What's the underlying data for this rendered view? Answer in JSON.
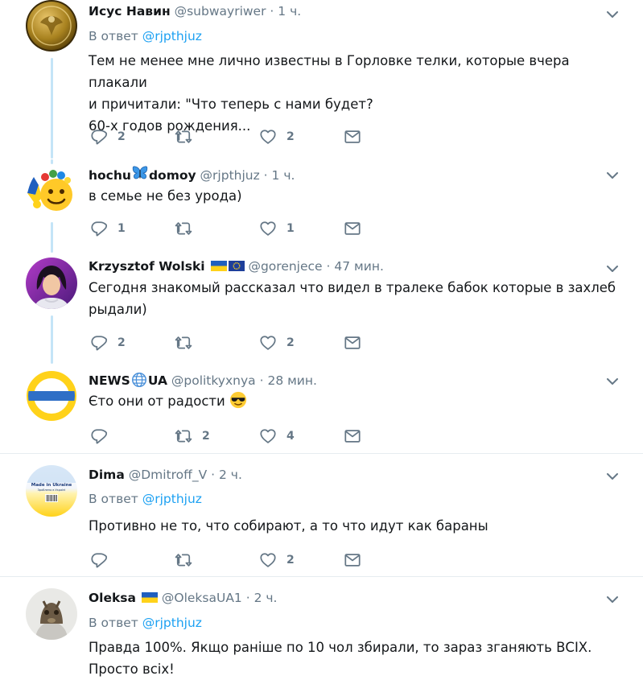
{
  "tweets": [
    {
      "name": "Исус Навин",
      "handle": "@subwayriwer",
      "time": "1 ч.",
      "reply_prefix": "В ответ",
      "reply_to": "@rjpthjuz",
      "text": [
        "Тем не менее мне лично известны в Горловке телки, которые вчера плакали",
        "и причитали: \"Что теперь с нами будет?",
        "60-х годов рождения..."
      ],
      "replies": "2",
      "retweets": "",
      "likes": "2"
    },
    {
      "name_part1": "hochu",
      "name_part2": "domoy",
      "handle": "@rjpthjuz",
      "time": "1 ч.",
      "text": [
        "в семье не без урода)"
      ],
      "replies": "1",
      "retweets": "",
      "likes": "1"
    },
    {
      "name": "Krzysztof Wolski",
      "handle": "@gorenjece",
      "time": "47 мин.",
      "text": [
        "Сегодня знакомый рассказал что видел в тралеке бабок которые в захлеб",
        "рыдали)"
      ],
      "replies": "2",
      "retweets": "",
      "likes": "2"
    },
    {
      "name_part1": "NEWS",
      "name_part2": "UA",
      "handle": "@politkyxnya",
      "time": "28 мин.",
      "text": [
        "Єто они от радости"
      ],
      "replies": "",
      "retweets": "2",
      "likes": "4"
    },
    {
      "name": "Dima",
      "handle": "@Dmitroff_V",
      "time": "2 ч.",
      "reply_prefix": "В ответ",
      "reply_to": "@rjpthjuz",
      "text": [
        "Противно не то, что собирают, а то что идут как бараны"
      ],
      "replies": "",
      "retweets": "",
      "likes": "2",
      "avatar_text": [
        "Made in Ukraine",
        "Зроблено в Україні"
      ]
    },
    {
      "name": "Oleksa",
      "handle": "@OleksaUA1",
      "time": "2 ч.",
      "reply_prefix": "В ответ",
      "reply_to": "@rjpthjuz",
      "text": [
        "Правда 100%. Якщо раніше по 10 чол збирали, то зараз зганяють ВСІХ.",
        "Просто всіх!"
      ]
    }
  ],
  "dot": "·",
  "colors": {
    "accent": "#1da1f2",
    "muted": "#657786",
    "thread_line": "#c4e4f7",
    "separator": "#e6ecf0"
  },
  "icons": {
    "reply": "reply-icon",
    "retweet": "retweet-icon",
    "like": "heart-icon",
    "dm": "envelope-icon",
    "more": "chevron-down-icon"
  }
}
